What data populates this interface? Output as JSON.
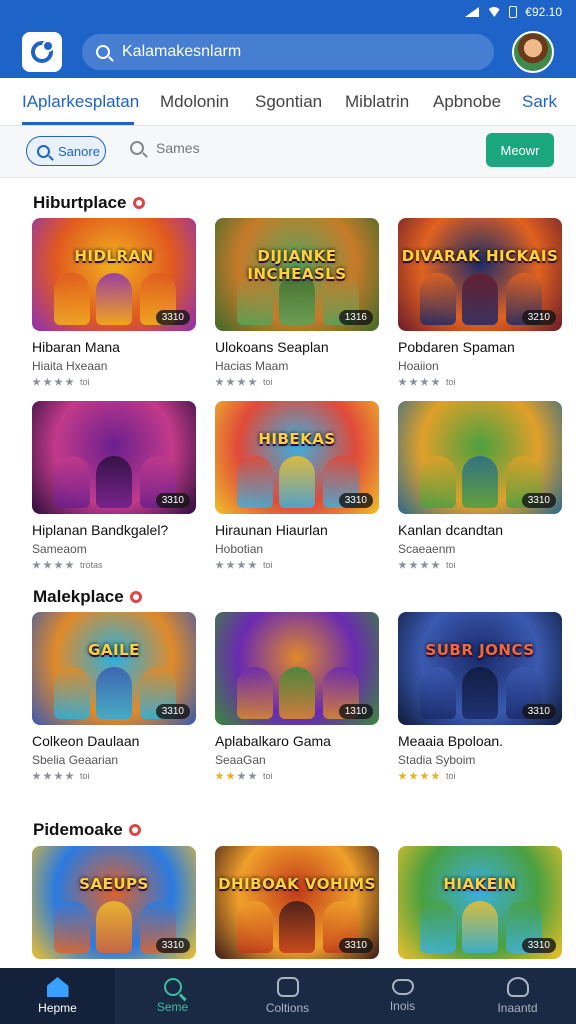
{
  "status_bar": {
    "time": "€92.10"
  },
  "header": {
    "logo_icon": "app-logo-icon",
    "search_placeholder": "Kalamakesnlarm",
    "avatar_icon": "user-avatar"
  },
  "tabs": [
    {
      "label": "IAplarkesplatan",
      "active": true
    },
    {
      "label": "Mdolonin",
      "active": false
    },
    {
      "label": "Sgontian",
      "active": false
    },
    {
      "label": "Miblatrin",
      "active": false
    },
    {
      "label": "Apbnobe",
      "active": false
    },
    {
      "label": "Sark",
      "active": false
    }
  ],
  "filters": {
    "active_chip": "Sanore",
    "plain_chip": "Sames",
    "new_button": "Meowr"
  },
  "sections": [
    {
      "title": "Hiburtplace",
      "items": [
        {
          "art_title": "HIDLRAN",
          "title": "Hibaran Mana",
          "sub": "Hiaita Hxeaan",
          "rating_text": "toi",
          "pill": "3310",
          "colors": [
            "#f2b21f",
            "#e05a1f",
            "#8e2fb5"
          ]
        },
        {
          "art_title": "DIJIANKE INCHEASLS",
          "title": "Ulokoans Seaplan",
          "sub": "Hacias Maam",
          "rating_text": "toi",
          "pill": "1316",
          "colors": [
            "#5aa35a",
            "#c77a2a",
            "#3d6a2a"
          ]
        },
        {
          "art_title": "DIVARAK HICKAIS",
          "title": "Pobdaren Spaman",
          "sub": "Hoaiion",
          "rating_text": "toi",
          "pill": "3210",
          "colors": [
            "#1b2a6a",
            "#e0621f",
            "#6a1b2a"
          ]
        }
      ]
    },
    {
      "title": "",
      "items": [
        {
          "art_title": "",
          "title": "Hiplanan Bandkgalel?",
          "sub": "Sameaom",
          "rating_text": "trotas",
          "pill": "3310",
          "colors": [
            "#6a1f8e",
            "#c23a8a",
            "#2a0f3a"
          ]
        },
        {
          "art_title": "HIBEKAS",
          "title": "Hiraunan Hiaurlan",
          "sub": "Hobotian",
          "rating_text": "toi",
          "pill": "3310",
          "colors": [
            "#3ab0e0",
            "#e04a3a",
            "#f0c02a"
          ]
        },
        {
          "art_title": "",
          "title": "Kanlan dcandtan",
          "sub": "Scaeaenm",
          "rating_text": "toi",
          "pill": "3310",
          "colors": [
            "#4aa040",
            "#e0a02a",
            "#2a6a8e"
          ]
        }
      ]
    },
    {
      "title": "Malekplace",
      "items": [
        {
          "art_title": "GAILE",
          "title": "Colkeon Daulaan",
          "sub": "Sbelia Geaarian",
          "rating_text": "toi",
          "pill": "3310",
          "colors": [
            "#2ab0e0",
            "#e08a2a",
            "#3a5ab0"
          ]
        },
        {
          "art_title": "",
          "title": "Aplabalkaro Gama",
          "sub": "SeaaGan",
          "rating_text": "toi",
          "pill": "1310",
          "colors": [
            "#e08a2a",
            "#6a2ab0",
            "#3a8a3a"
          ]
        },
        {
          "art_title": "SUBR JONCS",
          "title": "Meaaia Bpoloan.",
          "sub": "Stadia Syboim",
          "rating_text": "toi",
          "pill": "3310",
          "colors": [
            "#1a2a6a",
            "#3a5ab0",
            "#0f1a3a"
          ]
        }
      ]
    },
    {
      "title": "Pidemoake",
      "items": [
        {
          "art_title": "SAEUPS",
          "title": "",
          "sub": "",
          "rating_text": "",
          "pill": "3310",
          "colors": [
            "#e0622a",
            "#2a7ae0",
            "#f0c02a"
          ]
        },
        {
          "art_title": "DHIBOAK VOHIMS",
          "title": "",
          "sub": "",
          "rating_text": "",
          "pill": "3310",
          "colors": [
            "#c23a1a",
            "#f0a02a",
            "#3a1a1a"
          ]
        },
        {
          "art_title": "HIAKEIN",
          "title": "",
          "sub": "",
          "rating_text": "",
          "pill": "3310",
          "colors": [
            "#3ab0e0",
            "#4aa040",
            "#f0c02a"
          ]
        }
      ]
    }
  ],
  "bottom_nav": [
    {
      "label": "Hepme",
      "icon": "home-icon",
      "active": true
    },
    {
      "label": "Seme",
      "icon": "search-icon",
      "active": false
    },
    {
      "label": "Coltions",
      "icon": "box-icon",
      "active": false
    },
    {
      "label": "Inois",
      "icon": "gamepad-icon",
      "active": false
    },
    {
      "label": "Inaantd",
      "icon": "user-icon",
      "active": false
    }
  ]
}
